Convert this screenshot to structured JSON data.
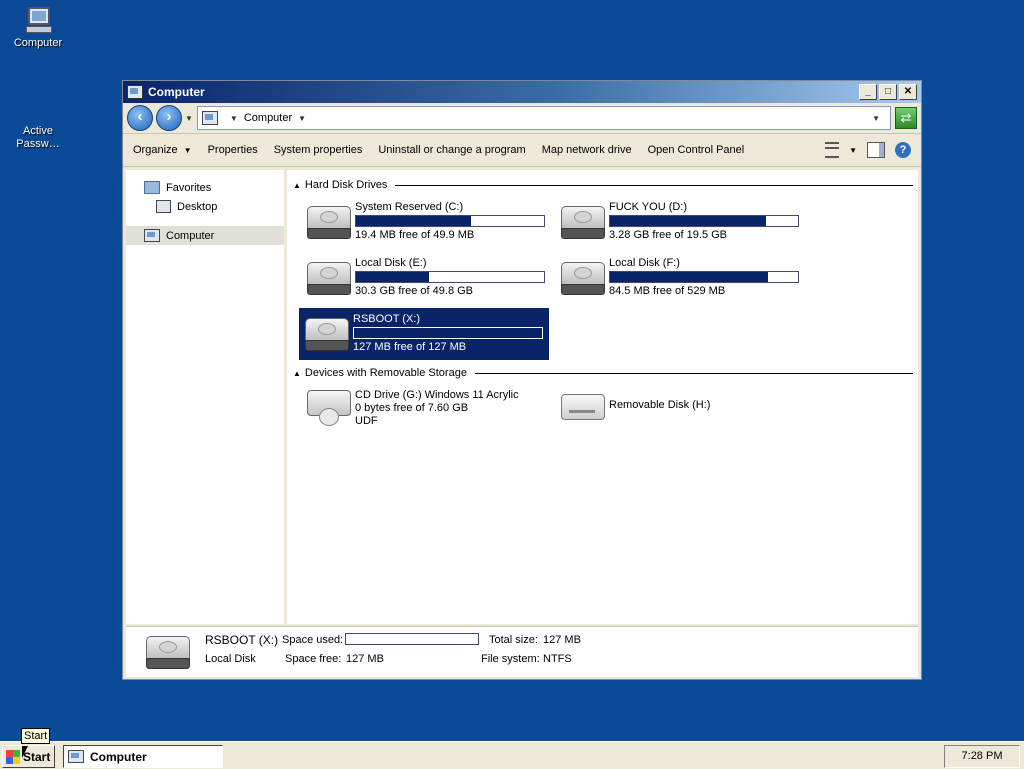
{
  "desktop": {
    "icons": [
      {
        "label": "Computer",
        "icon": "computer-icon"
      },
      {
        "label": "Active Passw…",
        "icon": "blank"
      }
    ]
  },
  "window": {
    "title": "Computer",
    "caption_buttons": {
      "minimize": "_",
      "maximize": "□",
      "close": "✕"
    },
    "address": {
      "segments": [
        "Computer"
      ]
    },
    "toolbar": {
      "organize": "Organize",
      "properties": "Properties",
      "system_properties": "System properties",
      "uninstall": "Uninstall or change a program",
      "map_drive": "Map network drive",
      "control_panel": "Open Control Panel"
    },
    "nav": {
      "favorites": "Favorites",
      "desktop": "Desktop",
      "computer": "Computer"
    },
    "groups": {
      "hard_disk": "Hard Disk Drives",
      "removable": "Devices with Removable Storage"
    },
    "drives": [
      {
        "name": "System Reserved (C:)",
        "free_text": "19.4 MB free of 49.9 MB",
        "used_fraction": 0.61
      },
      {
        "name": "FUCK YOU (D:)",
        "free_text": "3.28 GB free of 19.5 GB",
        "used_fraction": 0.83
      },
      {
        "name": "Local Disk (E:)",
        "free_text": "30.3 GB free of 49.8 GB",
        "used_fraction": 0.39
      },
      {
        "name": "Local Disk (F:)",
        "free_text": "84.5 MB free of 529 MB",
        "used_fraction": 0.84
      },
      {
        "name": "RSBOOT (X:)",
        "free_text": "127 MB free of 127 MB",
        "used_fraction": 0.0,
        "selected": true
      }
    ],
    "removable": [
      {
        "name": "CD Drive (G:) Windows 11 Acrylic",
        "line2": "0 bytes free of 7.60 GB",
        "line3": "UDF"
      },
      {
        "name": "Removable Disk (H:)"
      }
    ],
    "details": {
      "title": "RSBOOT (X:)",
      "type": "Local Disk",
      "space_used_label": "Space used:",
      "space_free_label": "Space free:",
      "space_free": "127 MB",
      "total_size_label": "Total size:",
      "total_size": "127 MB",
      "file_system_label": "File system:",
      "file_system": "NTFS",
      "used_fraction": 0.0
    }
  },
  "taskbar": {
    "start": "Start",
    "start_tooltip": "Start",
    "task": "Computer",
    "clock": "7:28 PM"
  },
  "colors": {
    "desktop": "#0a4a96",
    "selection": "#0a246a",
    "chrome": "#ece9d8"
  }
}
